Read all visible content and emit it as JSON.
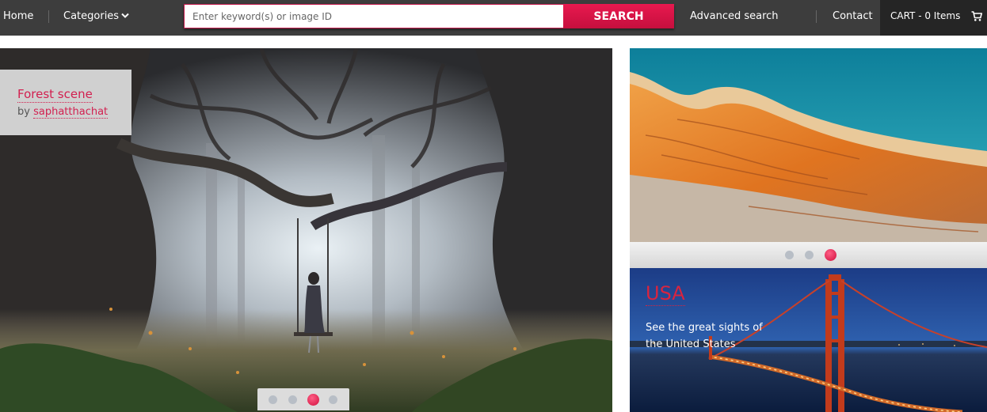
{
  "nav": {
    "home": "Home",
    "categories": "Categories",
    "search_placeholder": "Enter keyword(s) or image ID",
    "search_button": "SEARCH",
    "advanced_search": "Advanced search",
    "contact": "Contact",
    "cart": "CART - 0 Items"
  },
  "featured": {
    "title": "Forest scene",
    "by": "by",
    "author": "saphatthachat",
    "slide_count": 4,
    "active_slide": 3
  },
  "side_slider": {
    "slide_count": 3,
    "active_slide": 3
  },
  "promo": {
    "title": "USA",
    "text": "See the great sights of the United States"
  },
  "colors": {
    "accent": "#d21f4f",
    "nav_bg": "#3d3d3d",
    "cart_bg": "#252525"
  }
}
